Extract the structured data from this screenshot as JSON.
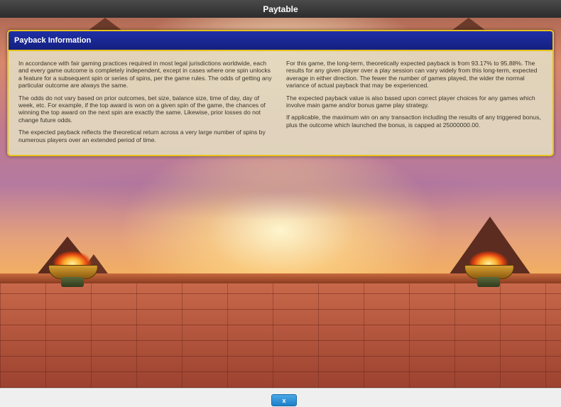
{
  "window": {
    "title": "Paytable"
  },
  "panel": {
    "title": "Payback Information",
    "left_paragraphs": [
      "In accordance with fair gaming practices required in most legal jurisdictions worldwide, each and every game outcome is completely independent, except in cases where one spin unlocks a feature for a subsequent spin or series of spins, per the game rules. The odds of getting any particular outcome are always the same.",
      "The odds do not vary based on prior outcomes, bet size, balance size, time of day, day of week, etc. For example, if the top award is won on a given spin of the game, the chances of winning the top award on the next spin are exactly the same. Likewise, prior losses do not change future odds.",
      "The expected payback reflects the theoretical return across a very large number of spins by numerous players over an extended period of time."
    ],
    "right_paragraphs": [
      "For this game, the long-term, theoretically expected payback is from 93.17% to 95.88%. The results for any given player over a play session can vary widely from this long-term, expected average in either direction. The fewer the number of games played, the wider the normal variance of actual payback that may be experienced.",
      "The expected payback value is also based upon correct player choices for any games which involve main game and/or bonus game play strategy.",
      "If applicable, the maximum win on any transaction including the results of any triggered bonus, plus the outcome which launched the bonus, is capped at 25000000.00."
    ]
  },
  "footer": {
    "close_label": "x"
  },
  "colors": {
    "panel_header": "#1f2fa6",
    "panel_border": "#e9c21a",
    "close_button": "#2f92d8"
  }
}
